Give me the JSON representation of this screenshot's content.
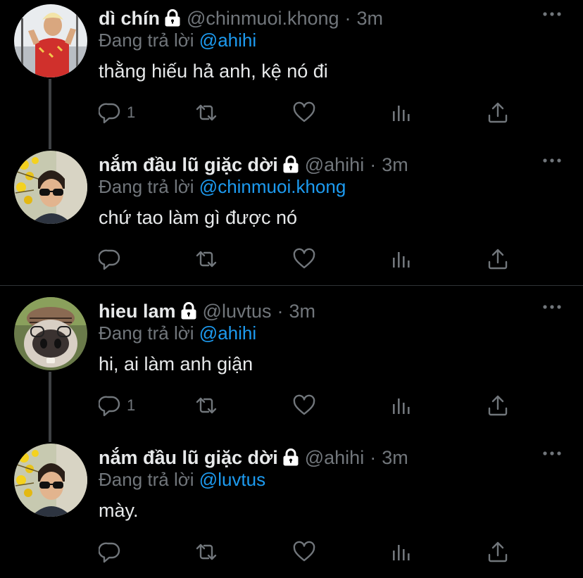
{
  "replying_prefix": "Đang trả lời",
  "accent_color": "#1d9bf0",
  "tweets": [
    {
      "name": "dì chín",
      "handle": "@chinmuoi.khong",
      "separator": "·",
      "time": "3m",
      "reply_to": "@ahihi",
      "text": "thằng hiếu hả anh, kệ nó đi",
      "reply_count": "1",
      "avatar": "avatar-photo-blonde"
    },
    {
      "name": "nắm đầu lũ giặc dời",
      "handle": "@ahihi",
      "separator": "·",
      "time": "3m",
      "reply_to": "@chinmuoi.khong",
      "text": "chứ tao làm gì được nó",
      "reply_count": "",
      "avatar": "avatar-photo-sunglasses"
    },
    {
      "name": "hieu lam",
      "handle": "@luvtus",
      "separator": "·",
      "time": "3m",
      "reply_to": "@ahihi",
      "text": "hi, ai làm anh giận",
      "reply_count": "1",
      "avatar": "avatar-photo-dog"
    },
    {
      "name": "nắm đầu lũ giặc dời",
      "handle": "@ahihi",
      "separator": "·",
      "time": "3m",
      "reply_to": "@luvtus",
      "text": "mày.",
      "reply_count": "",
      "avatar": "avatar-photo-sunglasses"
    }
  ]
}
